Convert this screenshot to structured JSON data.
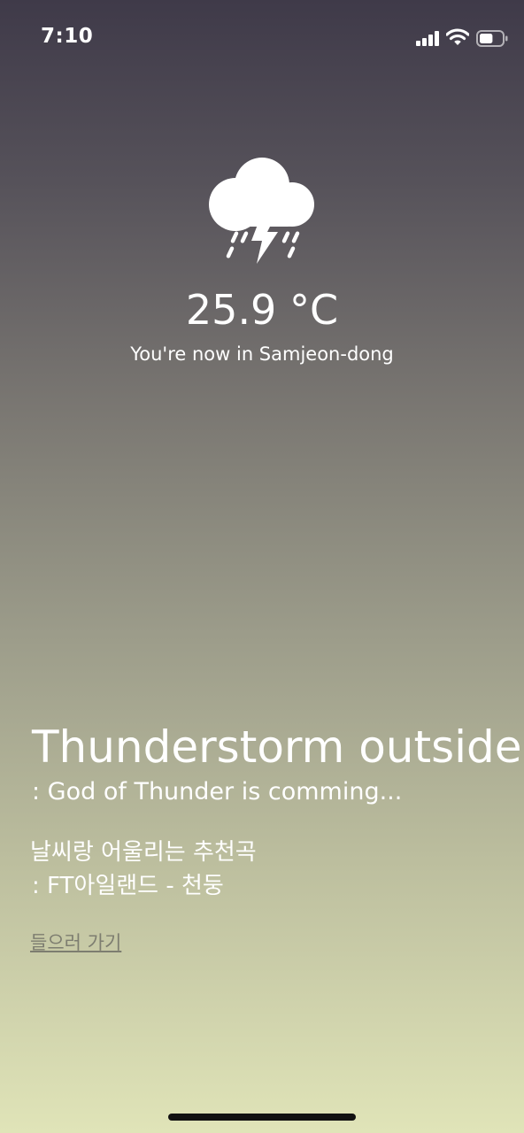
{
  "status_bar": {
    "time": "7:10",
    "signal_icon": "cellular-signal-icon",
    "wifi_icon": "wifi-icon",
    "battery_icon": "battery-icon",
    "battery_level": 0.6
  },
  "weather": {
    "icon": "thunderstorm-cloud-icon",
    "temperature": "25.9 °C",
    "location_text": "You're now in Samjeon-dong",
    "title": "Thunderstorm outside",
    "subtitle": " : God of Thunder is comming..."
  },
  "recommendation": {
    "heading": "날씨랑 어울리는 추천곡",
    "song": " : FT아일랜드 - 천둥",
    "link_label": "들으러 가기"
  },
  "colors": {
    "gradient_top": "#3f3a49",
    "gradient_bottom": "#e0e4b8",
    "text": "#ffffff",
    "link": "#7d7d70"
  }
}
